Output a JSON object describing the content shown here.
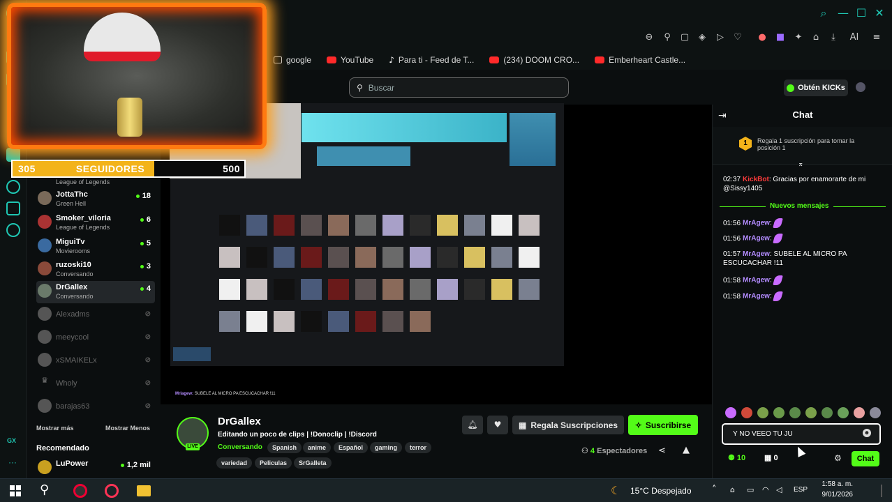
{
  "bookmarks": [
    "google",
    "YouTube",
    "Para ti - Feed de T...",
    "(234) DOOM CRO...",
    "Emberheart Castle..."
  ],
  "header": {
    "search_placeholder": "Buscar",
    "kicks_label": "Obtén KICKs"
  },
  "overlay": {
    "followers_current": "305",
    "followers_label": "SEGUIDORES",
    "followers_goal": "500",
    "followers_progress": 0.61
  },
  "sidebar": {
    "channels": [
      {
        "name": "",
        "game": "League of Legends",
        "viewers": ""
      },
      {
        "name": "JottaThc",
        "game": "Green Hell",
        "viewers": "18"
      },
      {
        "name": "Smoker_viloria",
        "game": "League of Legends",
        "viewers": "6"
      },
      {
        "name": "MiguiTv",
        "game": "Movierooms",
        "viewers": "5"
      },
      {
        "name": "ruzoski10",
        "game": "Conversando",
        "viewers": "3"
      },
      {
        "name": "DrGallex",
        "game": "Conversando",
        "viewers": "4"
      }
    ],
    "offline": [
      "Alexadms",
      "meeycool",
      "xSMAIKELx",
      "Wholy",
      "barajas63"
    ],
    "show_more": "Mostrar más",
    "show_less": "Mostrar Menos",
    "recommended_title": "Recomendado",
    "recommended": [
      {
        "name": "LuPower",
        "viewers": "1,2 mil"
      }
    ]
  },
  "stream": {
    "chat_ticker_user": "Mrlagew:",
    "chat_ticker_text": "SUBELE AL MICRO PA ESCUCACHAR !11",
    "streamer": "DrGallex",
    "title": "Editando un poco de clips | !Donoclip | !Discord",
    "category": "Conversando",
    "live": "LIVE",
    "tags": [
      "Spanish",
      "anime",
      "Español",
      "gaming",
      "terror",
      "variedad",
      "Peliculas",
      "SrGalleta"
    ],
    "gift_label": "Regala Suscripciones",
    "subscribe_label": "Suscribirse",
    "viewers": "4",
    "viewers_label": "Espectadores"
  },
  "chat": {
    "title": "Chat",
    "pinned": "Regala 1 suscripción para tomar la posición 1",
    "pinned_rank": "1",
    "new_messages": "Nuevos mensajes",
    "messages": [
      {
        "time": "02:37",
        "user": "KickBot",
        "text": "Gracias por enamorarte de mi @Sissy1405",
        "color": "#ff3b3b"
      },
      {
        "time": "01:56",
        "user": "MrAgew",
        "text": "",
        "emote": true
      },
      {
        "time": "01:56",
        "user": "MrAgew",
        "text": "",
        "emote": true
      },
      {
        "time": "01:57",
        "user": "MrAgew",
        "text": "SUBELE AL MICRO PA ESCUCACHAR !11",
        "emote": false
      },
      {
        "time": "01:58",
        "user": "MrAgew",
        "text": "",
        "emote": true
      },
      {
        "time": "01:58",
        "user": "MrAgew",
        "text": "",
        "emote": true
      }
    ],
    "input_value": "Y NO VEEO TU JU",
    "points": "10",
    "gifts": "0",
    "send_label": "Chat"
  },
  "taskbar": {
    "weather": "15°C Despejado",
    "lang": "ESP",
    "time": "1:58 a. m.",
    "date": "9/01/2026"
  },
  "colors": {
    "accent": "#53fc18",
    "opera": "#1fc7b3",
    "chat_user": "#b48cff"
  }
}
